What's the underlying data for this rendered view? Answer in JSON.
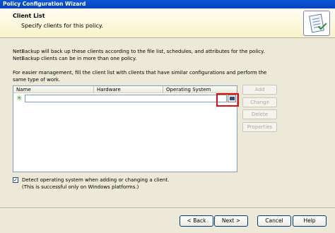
{
  "window": {
    "title": "Policy Configuration Wizard"
  },
  "header": {
    "title": "Client List",
    "subtitle": "Specify clients for this policy.",
    "icon": "wizard-checklist-icon"
  },
  "intro": {
    "line1": "NetBackup will back up these clients according to the file list, schedules, and attributes for the policy.  NetBackup clients can be in more than one policy.",
    "line2": "For easier management, fill the client list with clients that have similar configurations and perform the same type of work."
  },
  "list": {
    "columns": [
      "Name",
      "Hardware",
      "Operating System"
    ],
    "new_row_value": "",
    "new_row_icon": "new-item-star-icon"
  },
  "side_buttons": {
    "add": "Add",
    "change": "Change",
    "delete": "Delete",
    "properties": "Properties"
  },
  "detect": {
    "checked": true,
    "label": "Detect operating system when adding or changing a client.",
    "note": "(This is successful only on Windows platforms.)"
  },
  "footer": {
    "back": "< Back",
    "next": "Next >",
    "cancel": "Cancel",
    "help": "Help"
  }
}
